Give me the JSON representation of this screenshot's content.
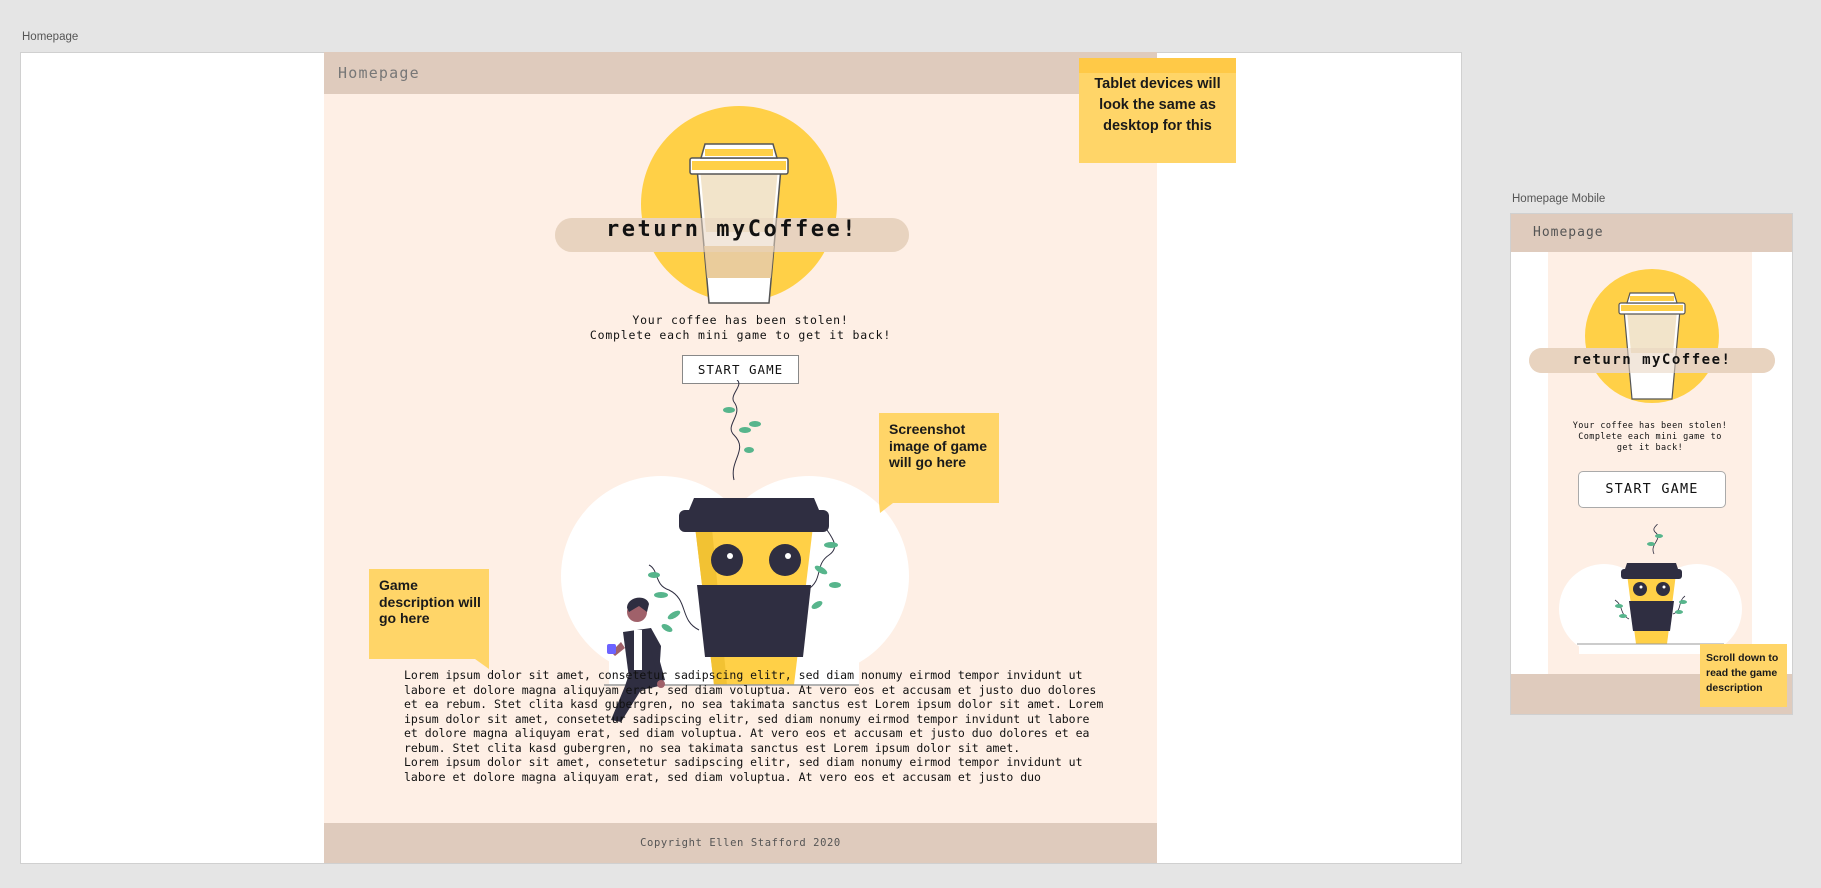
{
  "desktop": {
    "frame_label": "Homepage",
    "header_title": "Homepage",
    "app_title": "return myCoffee!",
    "tagline_line1": "Your coffee has been stolen!",
    "tagline_line2": "Complete each mini game to get it back!",
    "start_button": "START GAME",
    "lorem_paragraphs": [
      "Lorem ipsum dolor sit amet, consetetur sadipscing elitr, sed diam nonumy eirmod tempor invidunt ut labore et dolore magna aliquyam erat, sed diam voluptua. At vero eos et accusam et justo duo dolores et ea rebum. Stet clita kasd gubergren, no sea takimata sanctus est Lorem ipsum dolor sit amet. Lorem ipsum dolor sit amet, consetetur sadipscing elitr, sed diam nonumy eirmod tempor invidunt ut labore et dolore magna aliquyam erat, sed diam voluptua. At vero eos et accusam et justo duo dolores et ea rebum. Stet clita kasd gubergren, no sea takimata sanctus est Lorem ipsum dolor sit amet.",
      "Lorem ipsum dolor sit amet, consetetur sadipscing elitr, sed diam nonumy eirmod tempor invidunt ut labore et dolore magna aliquyam erat, sed diam voluptua. At vero eos et accusam et justo duo"
    ],
    "footer": "Copyright Ellen Stafford 2020"
  },
  "mobile": {
    "frame_label": "Homepage Mobile",
    "header_title": "Homepage",
    "app_title": "return myCoffee!",
    "tagline_line1": "Your coffee has been stolen!",
    "tagline_line2": "Complete each mini game to",
    "tagline_line3": "get it back!",
    "start_button": "START GAME"
  },
  "notes": {
    "tablet": "Tablet devices will look the same as desktop for this",
    "screenshot": "Screenshot image of game will go here",
    "description": "Game description will go here",
    "scroll": "Scroll down to read the game description"
  },
  "colors": {
    "canvas": "#e5e5e5",
    "header": "#dfcbbd",
    "page_bg": "#feefe5",
    "accent_yellow": "#ffd047",
    "sticky": "#ffd568",
    "dark": "#2f2e41",
    "leaf": "#57b58c"
  },
  "icons": [
    "coffee-cup-logo-icon",
    "coffee-character-illustration",
    "person-sitting-illustration"
  ]
}
